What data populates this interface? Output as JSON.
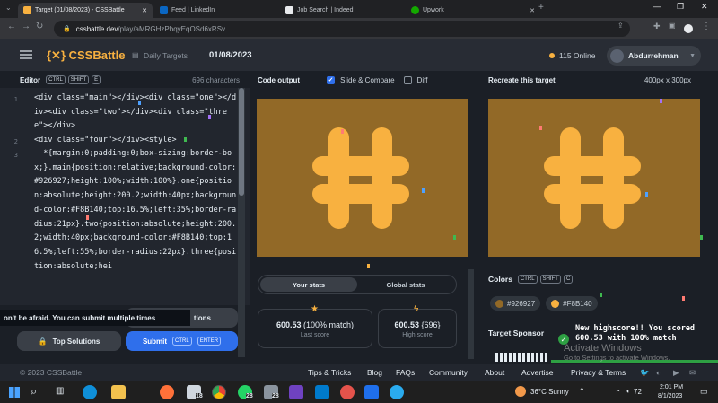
{
  "browser": {
    "tabs": [
      {
        "title": "Target (01/08/2023) - CSSBattle",
        "active": true
      },
      {
        "title": "Feed | LinkedIn",
        "active": false
      },
      {
        "title": "Job Search | Indeed",
        "active": false
      },
      {
        "title": "Upwork",
        "active": false
      }
    ],
    "url_domain": "cssbattle.dev",
    "url_path": "/play/aMRGHzPbqyEqOSd6xRSv"
  },
  "header": {
    "logo": "CSSBattle",
    "daily_targets": "Daily Targets",
    "date": "01/08/2023",
    "online": "115 Online",
    "username": "Abdurrehman"
  },
  "editor": {
    "title": "Editor",
    "keys": [
      "CTRL",
      "SHIFT",
      "E"
    ],
    "char_count": "696 characters",
    "lines": [
      {
        "no": "1",
        "text": "<div class=\"main\"></div><div class=\"one\"></div><div class=\"two\"></div><div class=\"three\"></div>"
      },
      {
        "no": "2",
        "text": "<div class=\"four\"></div><style>"
      },
      {
        "no": "3",
        "text": "  *{margin:0;padding:0;box-sizing:border-box;}.main{position:relative;background-color:#926927;height:100%;width:100%}.one{position:absolute;height:200.2;width:40px;background-color:#F8B140;top:16.5%;left:35%;border-radius:21px}.two{position:absolute;height:200.2;width:40px;background-color:#F8B140;top:16.5%;left:55%;border-radius:22px}.three{position:absolute;hei"
      }
    ]
  },
  "output": {
    "title": "Code output",
    "slide_compare": "Slide & Compare",
    "diff": "Diff",
    "your_stats": "Your stats",
    "global_stats": "Global stats",
    "last_score_value": "600.53",
    "last_score_match": "(100% match)",
    "last_score_label": "Last score",
    "high_score_value": "600.53",
    "high_score_extra": "{696}",
    "high_score_label": "High score"
  },
  "target": {
    "title": "Recreate this target",
    "size": "400px x 300px",
    "colors_label": "Colors",
    "color_keys": [
      "CTRL",
      "SHIFT",
      "C"
    ],
    "colors": [
      "#926927",
      "#F8B140"
    ],
    "sponsor_label": "Target Sponsor"
  },
  "actions": {
    "tooltip": "on't be afraid. You can submit multiple times",
    "solutions_label": "tions",
    "top_solutions": "Top Solutions",
    "submit": "Submit",
    "submit_keys": [
      "CTRL",
      "ENTER"
    ]
  },
  "toast": {
    "message": "New highscore!! You scored 600.53 with 100% match"
  },
  "watermark": {
    "line1": "Activate Windows",
    "line2": "Go to Settings to activate Windows."
  },
  "footer": {
    "copyright": "© 2023 CSSBattle",
    "links": [
      "Tips & Tricks",
      "Blog",
      "FAQs",
      "Community",
      "About",
      "Advertise",
      "Privacy & Terms"
    ]
  },
  "taskbar": {
    "weather": "36°C  Sunny",
    "time": "2:01 PM",
    "date": "8/1/2023",
    "volume": "72",
    "badges": [
      "18",
      "28",
      "28"
    ]
  },
  "colors": {
    "bg": "#926927",
    "fg": "#F8B140",
    "accent_blue": "#2f6feb"
  }
}
